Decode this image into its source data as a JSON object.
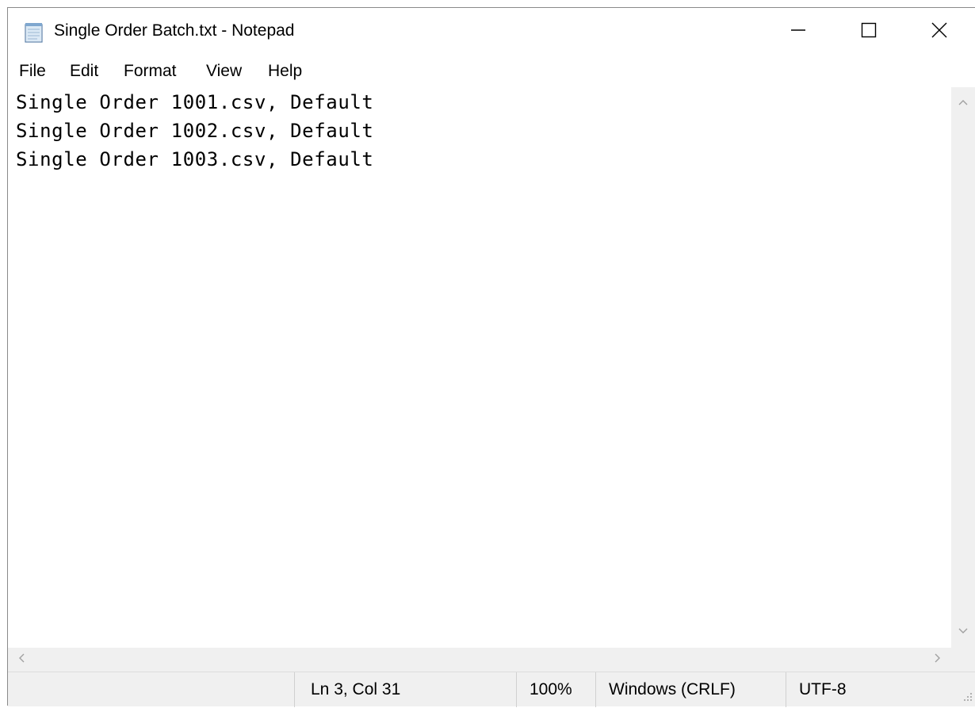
{
  "window": {
    "title": "Single Order Batch.txt - Notepad",
    "app_icon": "notepad-icon"
  },
  "title_controls": {
    "minimize_icon": "minimize-icon",
    "maximize_icon": "maximize-icon",
    "close_icon": "close-icon"
  },
  "menu": {
    "items": [
      {
        "label": "File"
      },
      {
        "label": "Edit"
      },
      {
        "label": "Format"
      },
      {
        "label": "View"
      },
      {
        "label": "Help"
      }
    ]
  },
  "editor": {
    "lines": [
      "Single Order 1001.csv, Default",
      "Single Order 1002.csv, Default",
      "Single Order 1003.csv, Default"
    ]
  },
  "statusbar": {
    "position": "Ln 3, Col 31",
    "zoom": "100%",
    "line_endings": "Windows (CRLF)",
    "encoding": "UTF-8"
  },
  "colors": {
    "background": "#ffffff",
    "chrome": "#f0f0f0",
    "text": "#000000",
    "scroll_arrow": "#a0a0a0"
  }
}
